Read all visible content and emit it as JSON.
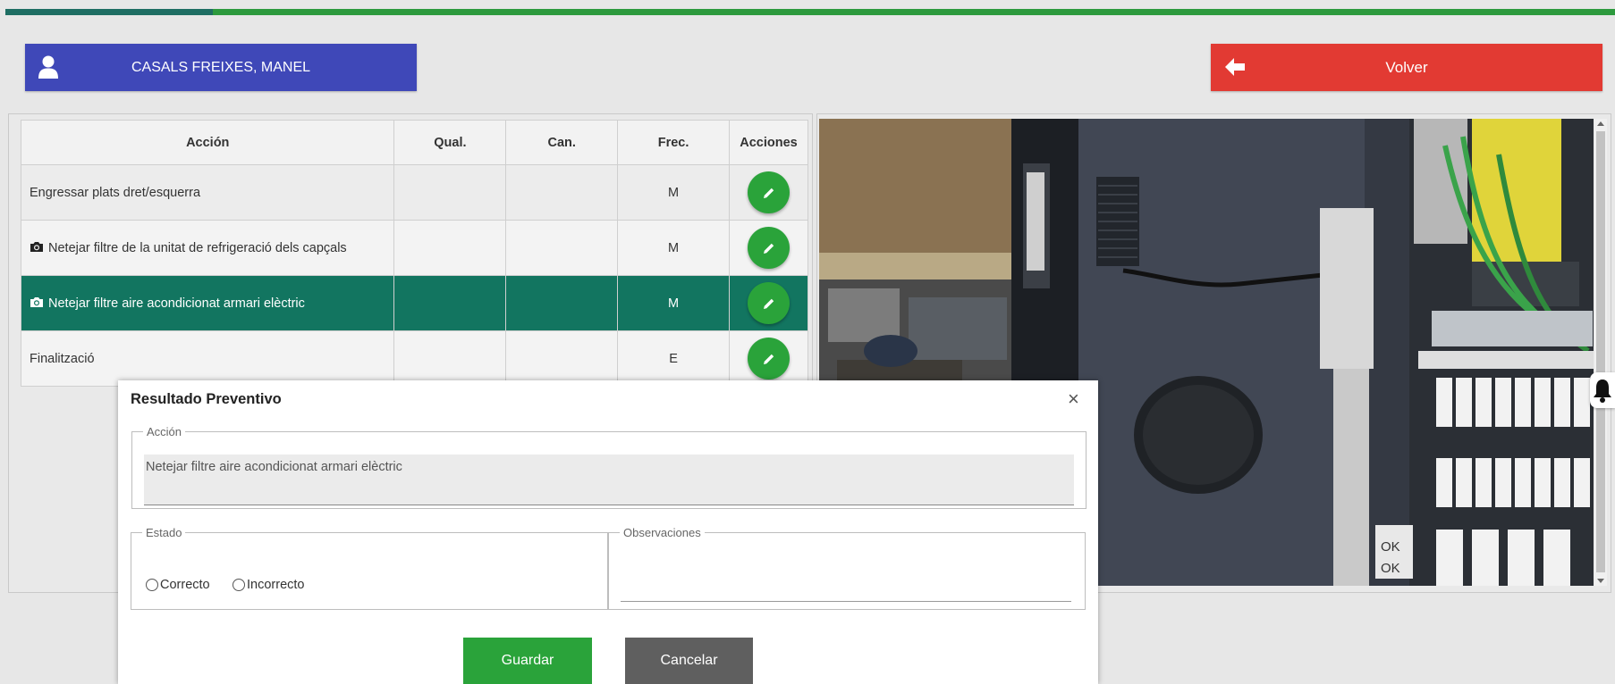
{
  "header": {
    "user_name": "CASALS FREIXES, MANEL",
    "back_label": "Volver",
    "colors": {
      "user_button": "#3f48b8",
      "back_button": "#e23a33",
      "progress_done": "#1f6e63",
      "progress_rest": "#2d9a3e"
    }
  },
  "table": {
    "columns": [
      "Acción",
      "Qual.",
      "Can.",
      "Frec.",
      "Acciones"
    ],
    "rows": [
      {
        "accion": "Engressar plats dret/esquerra",
        "qual": "",
        "can": "",
        "frec": "M",
        "has_photo": false,
        "selected": false
      },
      {
        "accion": "Netejar filtre de la unitat de refrigeració dels capçals",
        "qual": "",
        "can": "",
        "frec": "M",
        "has_photo": true,
        "selected": false
      },
      {
        "accion": "Netejar filtre aire acondicionat armari elèctric",
        "qual": "",
        "can": "",
        "frec": "M",
        "has_photo": true,
        "selected": true
      },
      {
        "accion": "Finalització",
        "qual": "",
        "can": "",
        "frec": "E",
        "has_photo": false,
        "selected": false
      }
    ],
    "action_icon": "pencil-icon",
    "selected_color": "#127560"
  },
  "photo": {
    "stickers": [
      "OK",
      "OK"
    ]
  },
  "modal": {
    "title": "Resultado Preventivo",
    "close_symbol": "×",
    "accion_legend": "Acción",
    "accion_value": "Netejar filtre aire acondicionat armari elèctric",
    "estado_legend": "Estado",
    "option_correct": "Correcto",
    "option_incorrect": "Incorrecto",
    "obs_legend": "Observaciones",
    "obs_value": "",
    "save_label": "Guardar",
    "cancel_label": "Cancelar"
  }
}
